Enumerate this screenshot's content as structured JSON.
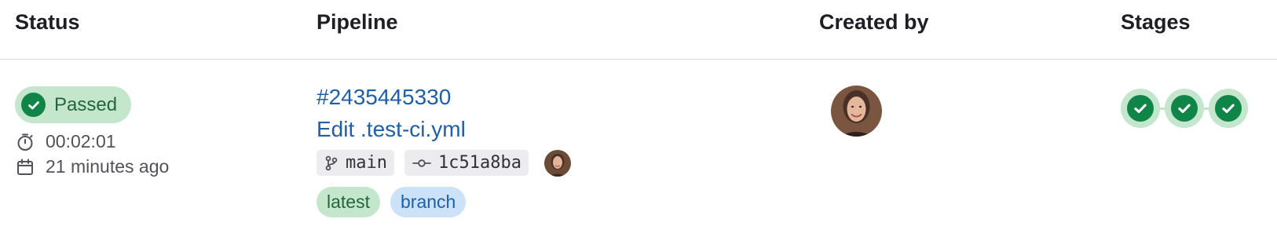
{
  "table": {
    "headers": {
      "status": "Status",
      "pipeline": "Pipeline",
      "created_by": "Created by",
      "stages": "Stages"
    }
  },
  "row": {
    "status": {
      "label": "Passed",
      "icon": "check-circle-icon",
      "color": "#108548",
      "duration": "00:02:01",
      "duration_icon": "timer-icon",
      "finished": "21 minutes ago",
      "finished_icon": "calendar-icon"
    },
    "pipeline": {
      "id": "#2435445330",
      "commit_title": "Edit .test-ci.yml",
      "branch": "main",
      "branch_icon": "branch-icon",
      "commit_sha": "1c51a8ba",
      "commit_icon": "commit-icon",
      "commit_author_icon": "avatar",
      "badges": [
        "latest",
        "branch"
      ]
    },
    "created_by": {
      "icon": "avatar"
    },
    "stages": [
      {
        "status": "passed",
        "icon": "check-circle-icon"
      },
      {
        "status": "passed",
        "icon": "check-circle-icon"
      },
      {
        "status": "passed",
        "icon": "check-circle-icon"
      }
    ]
  }
}
